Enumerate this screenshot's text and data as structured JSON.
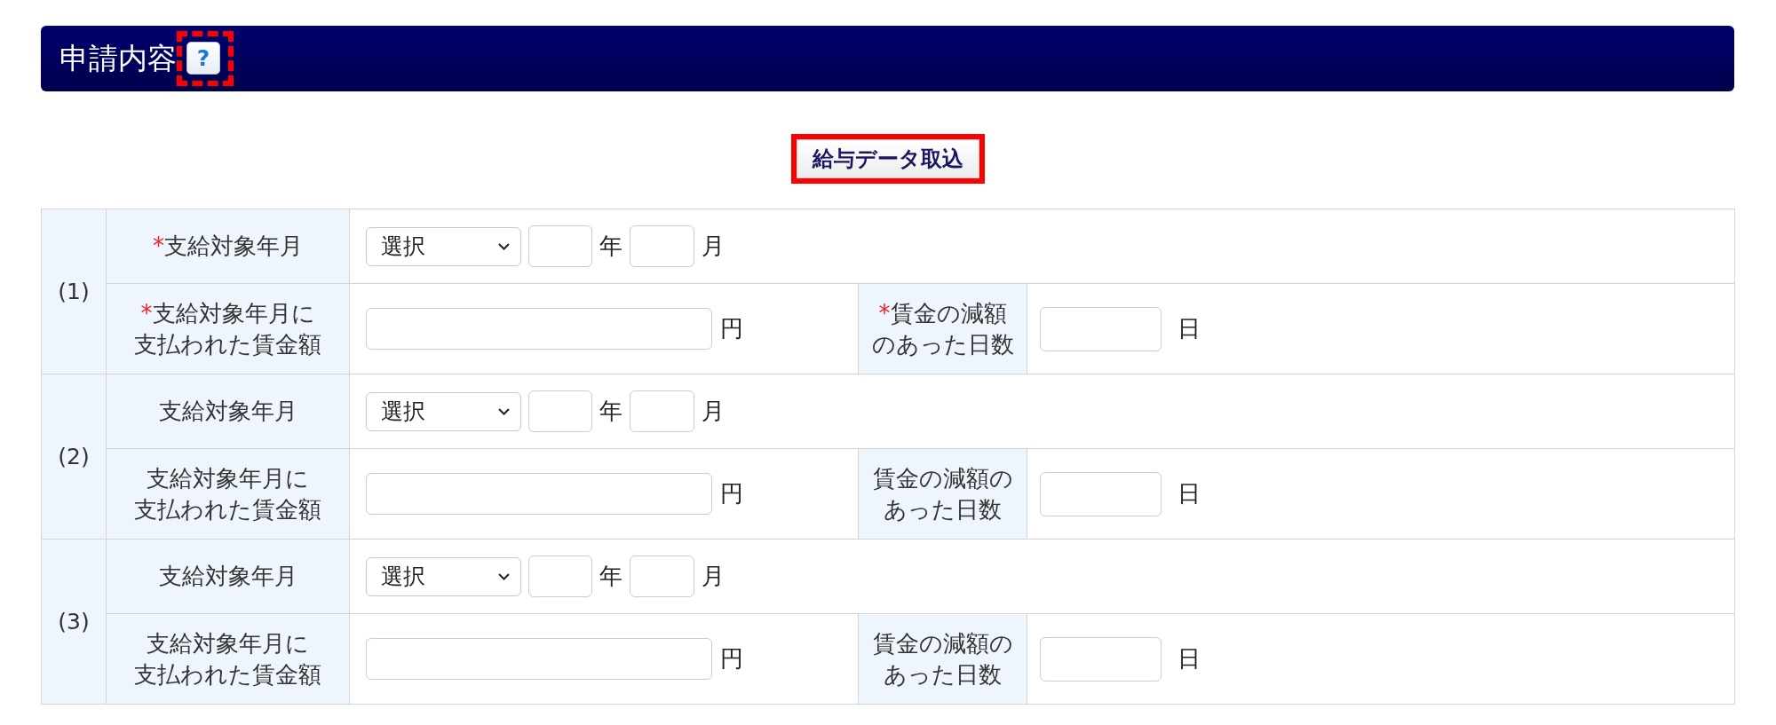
{
  "section_header": {
    "title": "申請内容",
    "help_button": {
      "label": "?",
      "highlighted": true,
      "dashed_frame": true
    }
  },
  "import_button": {
    "label": "給与データ取込",
    "highlighted": true,
    "dashed_frame": false
  },
  "entries": [
    {
      "number": "(1)",
      "payment_month": {
        "label": {
          "mark": "*",
          "lines": [
            "支給対象年月"
          ]
        },
        "select": {
          "value": "選択"
        },
        "year_unit": "年",
        "month_unit": "月"
      },
      "wage_paid": {
        "label": {
          "mark": "*",
          "lines": [
            "支給対象年月に",
            "支払われた賃金額"
          ]
        },
        "unit": "円"
      },
      "reduced_days": {
        "label": {
          "mark": "*",
          "lines": [
            "賃金の減額",
            "のあった日数"
          ]
        },
        "unit": "日"
      }
    },
    {
      "number": "(2)",
      "payment_month": {
        "label": {
          "lines": [
            "支給対象年月"
          ]
        },
        "select": {
          "value": "選択"
        },
        "year_unit": "年",
        "month_unit": "月"
      },
      "wage_paid": {
        "label": {
          "lines": [
            "支給対象年月に",
            "支払われた賃金額"
          ]
        },
        "unit": "円"
      },
      "reduced_days": {
        "label": {
          "lines": [
            "賃金の減額の",
            "あった日数"
          ]
        },
        "unit": "日"
      }
    },
    {
      "number": "(3)",
      "payment_month": {
        "label": {
          "lines": [
            "支給対象年月"
          ]
        },
        "select": {
          "value": "選択"
        },
        "year_unit": "年",
        "month_unit": "月"
      },
      "wage_paid": {
        "label": {
          "lines": [
            "支給対象年月に",
            "支払われた賃金額"
          ]
        },
        "unit": "円"
      },
      "reduced_days": {
        "label": {
          "lines": [
            "賃金の減額の",
            "あった日数"
          ]
        },
        "unit": "日"
      }
    }
  ]
}
